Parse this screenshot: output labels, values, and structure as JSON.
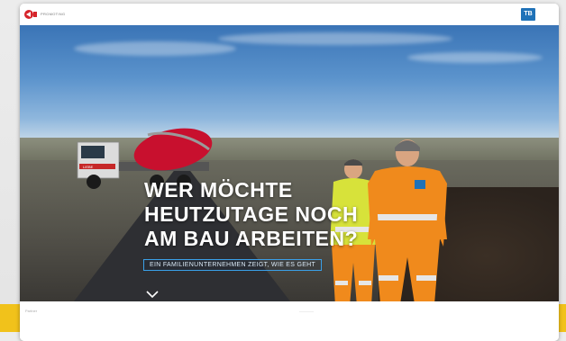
{
  "header": {
    "brand_small": "PROMOTING",
    "logo_right_text": "TB"
  },
  "hero": {
    "headline_lines": [
      "WER MÖCHTE",
      "HEUTZUTAGE NOCH",
      "AM BAU ARBEITEN?"
    ],
    "subline": "EIN FAMILIENUNTERNEHMEN ZEIGT, WIE ES GEHT",
    "truck_label": "LIEBE"
  },
  "below": {
    "left_text": "Partner",
    "center_text": "————"
  },
  "colors": {
    "accent_yellow": "#f1c21b",
    "brand_blue": "#1f72b8",
    "outline_blue": "#3aa0e8",
    "hiviz_orange": "#f08a1c",
    "hiviz_yellow": "#d7e23a"
  },
  "icons": {
    "scroll": "chevron-down-icon",
    "brand": "company-logo"
  }
}
